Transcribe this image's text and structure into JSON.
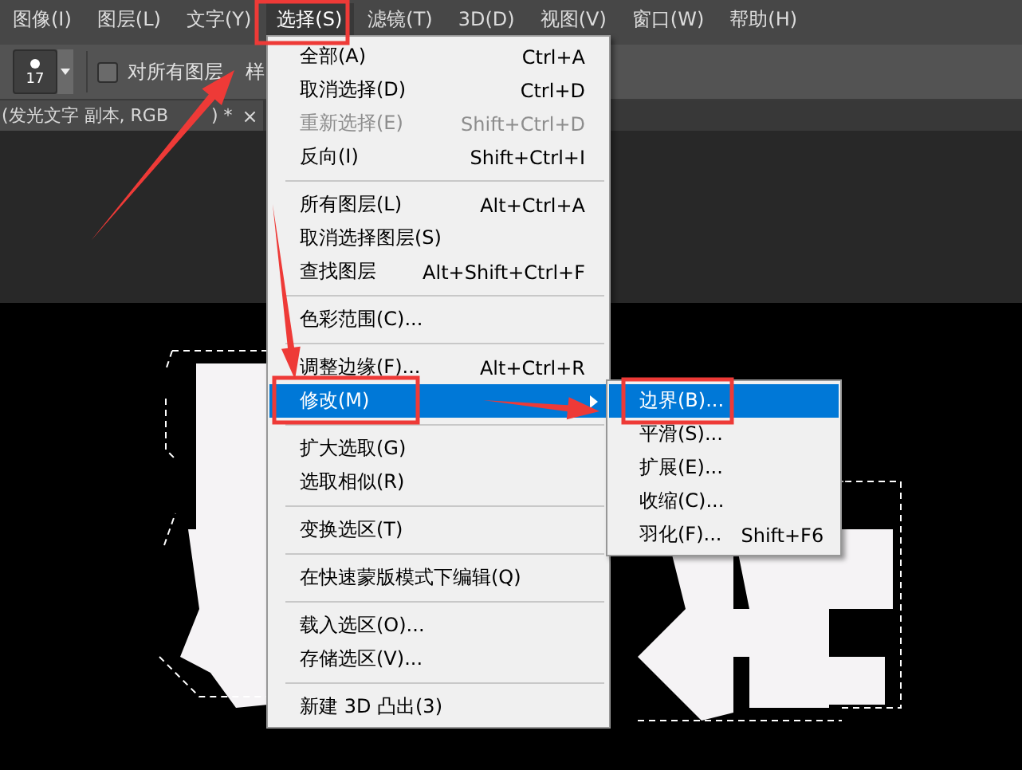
{
  "menubar": [
    {
      "label": "图像(I)",
      "selected": false
    },
    {
      "label": "图层(L)",
      "selected": false
    },
    {
      "label": "文字(Y)",
      "selected": false
    },
    {
      "label": "选择(S)",
      "selected": true
    },
    {
      "label": "滤镜(T)",
      "selected": false
    },
    {
      "label": "3D(D)",
      "selected": false
    },
    {
      "label": "视图(V)",
      "selected": false
    },
    {
      "label": "窗口(W)",
      "selected": false
    },
    {
      "label": "帮助(H)",
      "selected": false
    }
  ],
  "options_bar": {
    "brush_size": "17",
    "sample_all_layers": {
      "label_start": "对所有图层",
      "label_end": "样",
      "checked": false
    }
  },
  "document_tab": {
    "title_start": "(发光文字 副本, RGB",
    "title_end": ") *",
    "close": "×"
  },
  "menu": [
    {
      "kind": "item",
      "label": "全部(A)",
      "shortcut": "Ctrl+A",
      "disabled": false,
      "selected": false,
      "has_submenu": false
    },
    {
      "kind": "item",
      "label": "取消选择(D)",
      "shortcut": "Ctrl+D",
      "disabled": false,
      "selected": false,
      "has_submenu": false
    },
    {
      "kind": "item",
      "label": "重新选择(E)",
      "shortcut": "Shift+Ctrl+D",
      "disabled": true,
      "selected": false,
      "has_submenu": false
    },
    {
      "kind": "item",
      "label": "反向(I)",
      "shortcut": "Shift+Ctrl+I",
      "disabled": false,
      "selected": false,
      "has_submenu": false
    },
    {
      "kind": "separator"
    },
    {
      "kind": "item",
      "label": "所有图层(L)",
      "shortcut": "Alt+Ctrl+A",
      "disabled": false,
      "selected": false,
      "has_submenu": false
    },
    {
      "kind": "item",
      "label": "取消选择图层(S)",
      "disabled": false,
      "selected": false,
      "has_submenu": false
    },
    {
      "kind": "item",
      "label": "查找图层",
      "shortcut": "Alt+Shift+Ctrl+F",
      "disabled": false,
      "selected": false,
      "has_submenu": false
    },
    {
      "kind": "separator"
    },
    {
      "kind": "item",
      "label": "色彩范围(C)...",
      "disabled": false,
      "selected": false,
      "has_submenu": false
    },
    {
      "kind": "separator"
    },
    {
      "kind": "item",
      "label": "调整边缘(F)...",
      "shortcut": "Alt+Ctrl+R",
      "disabled": false,
      "selected": false,
      "has_submenu": false
    },
    {
      "kind": "item",
      "label": "修改(M)",
      "disabled": false,
      "selected": true,
      "has_submenu": true
    },
    {
      "kind": "separator"
    },
    {
      "kind": "item",
      "label": "扩大选取(G)",
      "disabled": false,
      "selected": false,
      "has_submenu": false
    },
    {
      "kind": "item",
      "label": "选取相似(R)",
      "disabled": false,
      "selected": false,
      "has_submenu": false
    },
    {
      "kind": "separator"
    },
    {
      "kind": "item",
      "label": "变换选区(T)",
      "disabled": false,
      "selected": false,
      "has_submenu": false
    },
    {
      "kind": "separator"
    },
    {
      "kind": "item",
      "label": "在快速蒙版模式下编辑(Q)",
      "disabled": false,
      "selected": false,
      "has_submenu": false
    },
    {
      "kind": "separator"
    },
    {
      "kind": "item",
      "label": "载入选区(O)...",
      "disabled": false,
      "selected": false,
      "has_submenu": false
    },
    {
      "kind": "item",
      "label": "存储选区(V)...",
      "disabled": false,
      "selected": false,
      "has_submenu": false
    },
    {
      "kind": "separator"
    },
    {
      "kind": "item",
      "label": "新建 3D 凸出(3)",
      "disabled": false,
      "selected": false,
      "has_submenu": false
    }
  ],
  "submenu": [
    {
      "kind": "item",
      "label": "边界(B)...",
      "disabled": false,
      "selected": true,
      "has_submenu": false
    },
    {
      "kind": "item",
      "label": "平滑(S)...",
      "disabled": false,
      "selected": false,
      "has_submenu": false
    },
    {
      "kind": "item",
      "label": "扩展(E)...",
      "disabled": false,
      "selected": false,
      "has_submenu": false
    },
    {
      "kind": "item",
      "label": "收缩(C)...",
      "disabled": false,
      "selected": false,
      "has_submenu": false
    },
    {
      "kind": "item",
      "label": "羽化(F)...",
      "shortcut": "Shift+F6",
      "disabled": false,
      "selected": false,
      "has_submenu": false
    }
  ]
}
